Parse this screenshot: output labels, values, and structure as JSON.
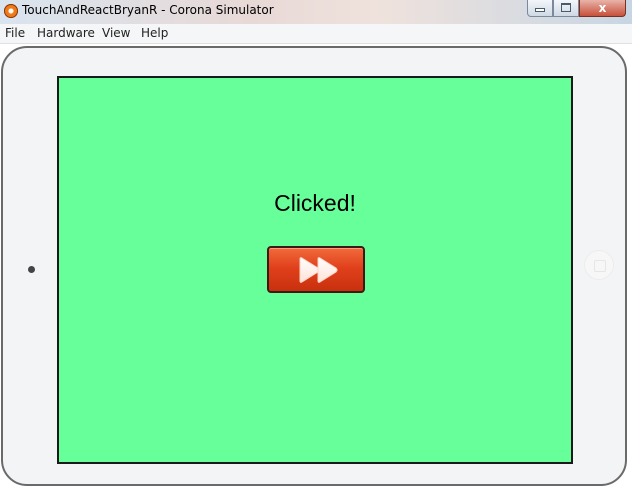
{
  "window": {
    "title": "TouchAndReactBryanR - Corona Simulator",
    "close_label": "x"
  },
  "menu": {
    "items": [
      "File",
      "Hardware",
      "View",
      "Help"
    ]
  },
  "screen": {
    "status_text": "Clicked!",
    "background_color": "#66ff99"
  },
  "button": {
    "icon": "fast-forward-icon",
    "color": "#e0411c"
  }
}
